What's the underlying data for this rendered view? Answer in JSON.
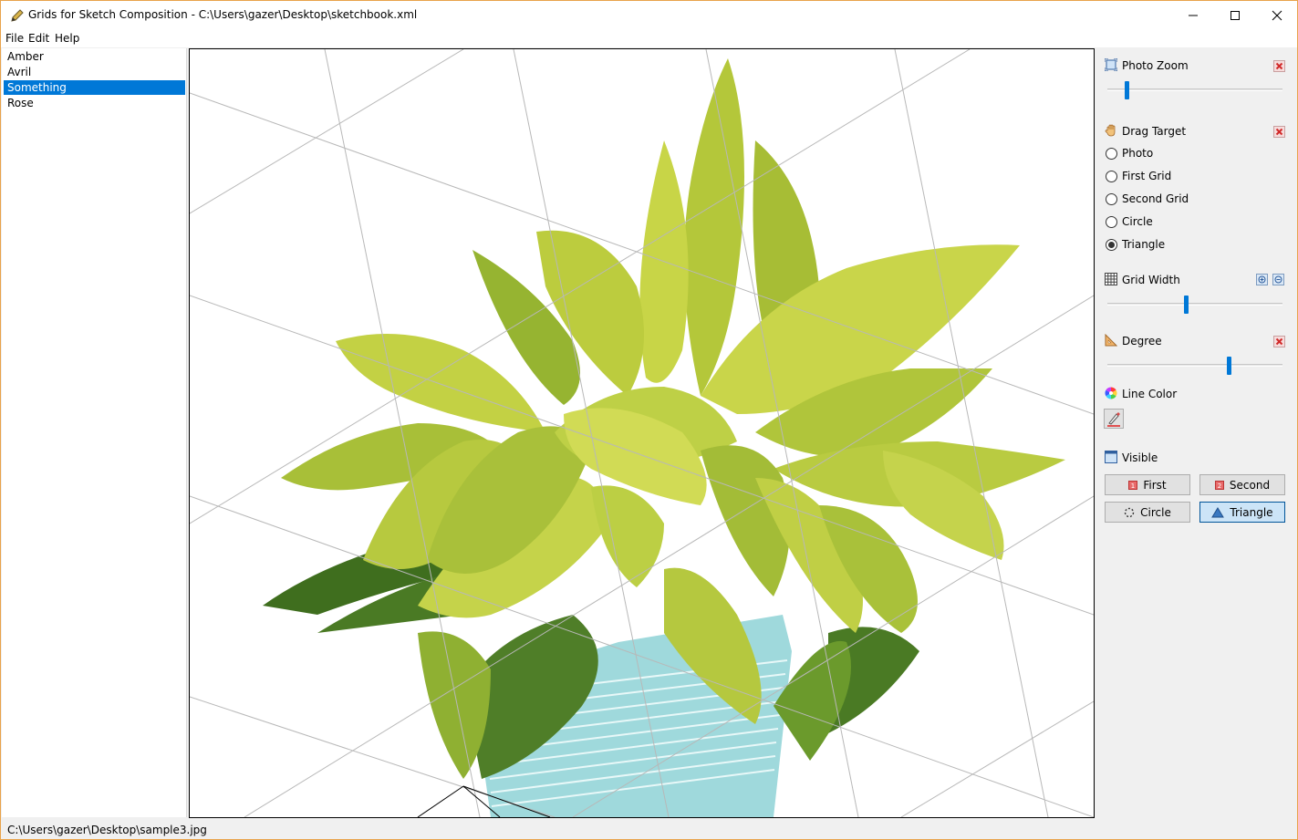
{
  "window": {
    "title": "Grids for Sketch Composition - C:\\Users\\gazer\\Desktop\\sketchbook.xml"
  },
  "menu": {
    "items": [
      {
        "label": "File"
      },
      {
        "label": "Edit"
      },
      {
        "label": "Help"
      }
    ]
  },
  "list": {
    "items": [
      {
        "label": "Amber",
        "selected": false
      },
      {
        "label": "Avril",
        "selected": false
      },
      {
        "label": "Something",
        "selected": true
      },
      {
        "label": "Rose",
        "selected": false
      }
    ]
  },
  "panel": {
    "photo_zoom": {
      "label": "Photo Zoom",
      "value": 0.1
    },
    "drag_target": {
      "label": "Drag Target",
      "options": [
        {
          "label": "Photo",
          "checked": false
        },
        {
          "label": "First Grid",
          "checked": false
        },
        {
          "label": "Second Grid",
          "checked": false
        },
        {
          "label": "Circle",
          "checked": false
        },
        {
          "label": "Triangle",
          "checked": true
        }
      ]
    },
    "grid_width": {
      "label": "Grid Width",
      "value": 0.45
    },
    "degree": {
      "label": "Degree",
      "value": 0.7
    },
    "line_color": {
      "label": "Line Color",
      "color": "#e05050"
    },
    "visible": {
      "label": "Visible",
      "buttons": [
        {
          "label": "First",
          "active": false
        },
        {
          "label": "Second",
          "active": false
        },
        {
          "label": "Circle",
          "active": false
        },
        {
          "label": "Triangle",
          "active": true
        }
      ]
    }
  },
  "status": {
    "path": "C:\\Users\\gazer\\Desktop\\sample3.jpg"
  },
  "colors": {
    "accent": "#0078d7",
    "window_border": "#e8a34b",
    "selection": "#0078d7"
  }
}
